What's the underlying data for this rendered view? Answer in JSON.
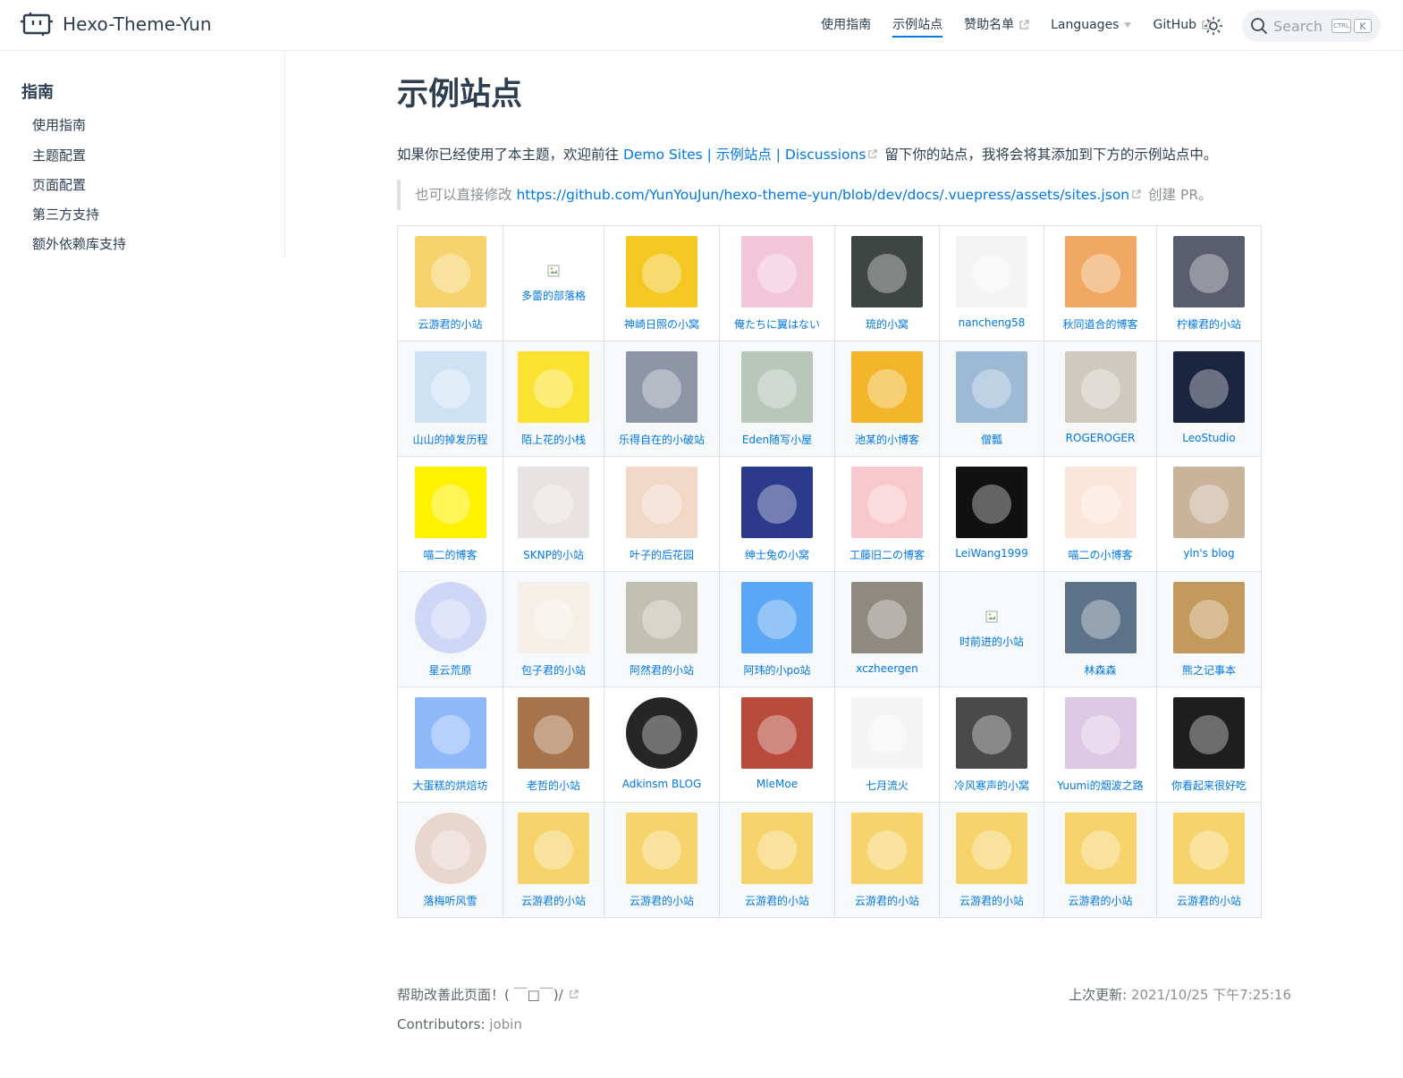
{
  "brand": {
    "title": "Hexo-Theme-Yun"
  },
  "nav": {
    "items": [
      {
        "label": "使用指南",
        "active": false,
        "external": false
      },
      {
        "label": "示例站点",
        "active": true,
        "external": false
      },
      {
        "label": "赞助名单",
        "active": false,
        "external": true
      },
      {
        "label": "Languages",
        "active": false,
        "external": false
      },
      {
        "label": "GitHub",
        "active": false,
        "external": true
      }
    ],
    "search": {
      "placeholder": "Search",
      "kbd_ctrl": "CTRL",
      "kbd_key": "K"
    }
  },
  "sidebar": {
    "heading": "指南",
    "items": [
      "使用指南",
      "主题配置",
      "页面配置",
      "第三方支持",
      "额外依赖库支持"
    ]
  },
  "main": {
    "title": "示例站点",
    "intro_before": "如果你已经使用了本主题，欢迎前往 ",
    "intro_link": "Demo Sites | 示例站点 | Discussions",
    "intro_after": " 留下你的站点，我将会将其添加到下方的示例站点中。",
    "tip_before": "也可以直接修改 ",
    "tip_link": "https://github.com/YunYouJun/hexo-theme-yun/blob/dev/docs/.vuepress/assets/sites.json",
    "tip_after": " 创建 PR。"
  },
  "sites": [
    [
      {
        "name": "云游君的小站",
        "color": "#f6d36b"
      },
      {
        "name": "多蕾的部落格",
        "broken": true
      },
      {
        "name": "神崎日照の小窝",
        "color": "#f3c823"
      },
      {
        "name": "俺たちに翼はない",
        "color": "#f1c7d8"
      },
      {
        "name": "琉的小窝",
        "color": "#3e4542"
      },
      {
        "name": "nancheng58",
        "color": "#f4f4f4"
      },
      {
        "name": "秋同道合的博客",
        "color": "#f0a863"
      },
      {
        "name": "柠檬君的小站",
        "color": "#5a5d6e"
      }
    ],
    [
      {
        "name": "山山的掉发历程",
        "color": "#cfe2f4"
      },
      {
        "name": "陌上花的小栈",
        "color": "#fbe230"
      },
      {
        "name": "乐得自在的小破站",
        "color": "#8e95a6"
      },
      {
        "name": "Eden随写小屋",
        "color": "#b9c7bb"
      },
      {
        "name": "池某的小博客",
        "color": "#f3b62b"
      },
      {
        "name": "僧瓢",
        "color": "#9cbad5"
      },
      {
        "name": "ROGEROGER",
        "color": "#cfc9c0"
      },
      {
        "name": "LeoStudio",
        "color": "#1c2540"
      }
    ],
    [
      {
        "name": "喵二的博客",
        "color": "#fff100"
      },
      {
        "name": "SKNP的小站",
        "color": "#e8e2e2"
      },
      {
        "name": "叶子的后花园",
        "color": "#f2d8c7"
      },
      {
        "name": "绅士兔の小窝",
        "color": "#2b3a8a"
      },
      {
        "name": "工藤旧二の博客",
        "color": "#f7c8cc"
      },
      {
        "name": "LeiWang1999",
        "color": "#111111"
      },
      {
        "name": "喵二の小博客",
        "color": "#fbe6dc"
      },
      {
        "name": "yln's blog",
        "color": "#c9b39b"
      }
    ],
    [
      {
        "name": "星云荒原",
        "color": "#cfd7f7",
        "round": true
      },
      {
        "name": "包子君的小站",
        "color": "#f5efe7"
      },
      {
        "name": "阿然君的小站",
        "color": "#c2c0b1"
      },
      {
        "name": "阿玮的小po站",
        "color": "#5aa7f5"
      },
      {
        "name": "xczheergen",
        "color": "#8f8a80"
      },
      {
        "name": "时前进的小站",
        "broken": true
      },
      {
        "name": "林森森",
        "color": "#5c7289"
      },
      {
        "name": "熊之记事本",
        "color": "#c49a5c"
      }
    ],
    [
      {
        "name": "大蛋糕的烘焙坊",
        "color": "#8fb8fb"
      },
      {
        "name": "老哲的小站",
        "color": "#a7734a"
      },
      {
        "name": "Adkinsm BLOG",
        "color": "#262626",
        "round": true
      },
      {
        "name": "MleMoe",
        "color": "#b74a3a"
      },
      {
        "name": "七月流火",
        "color": "#f4f4f4"
      },
      {
        "name": "冷风寒声的小窝",
        "color": "#4a4a4a"
      },
      {
        "name": "Yuumi的烟波之路",
        "color": "#ddc9e6"
      },
      {
        "name": "你看起来很好吃",
        "color": "#1e1e1e"
      }
    ],
    [
      {
        "name": "落梅听风雪",
        "color": "#e8d6cf",
        "round": true
      },
      {
        "name": "云游君的小站",
        "color": "#f6d36b"
      },
      {
        "name": "云游君的小站",
        "color": "#f6d36b"
      },
      {
        "name": "云游君的小站",
        "color": "#f6d36b"
      },
      {
        "name": "云游君的小站",
        "color": "#f6d36b"
      },
      {
        "name": "云游君的小站",
        "color": "#f6d36b"
      },
      {
        "name": "云游君的小站",
        "color": "#f6d36b"
      },
      {
        "name": "云游君的小站",
        "color": "#f6d36b"
      }
    ]
  ],
  "footer": {
    "edit_link": "帮助改善此页面！( ￣□￣)/",
    "last_updated_label": "上次更新:",
    "last_updated_value": "2021/10/25 下午7:25:16",
    "contributors_label": "Contributors:",
    "contributors_value": "jobin"
  },
  "colors": {
    "accent": "#0078e7",
    "text": "#2c3e50",
    "border": "#dfe2e5"
  }
}
